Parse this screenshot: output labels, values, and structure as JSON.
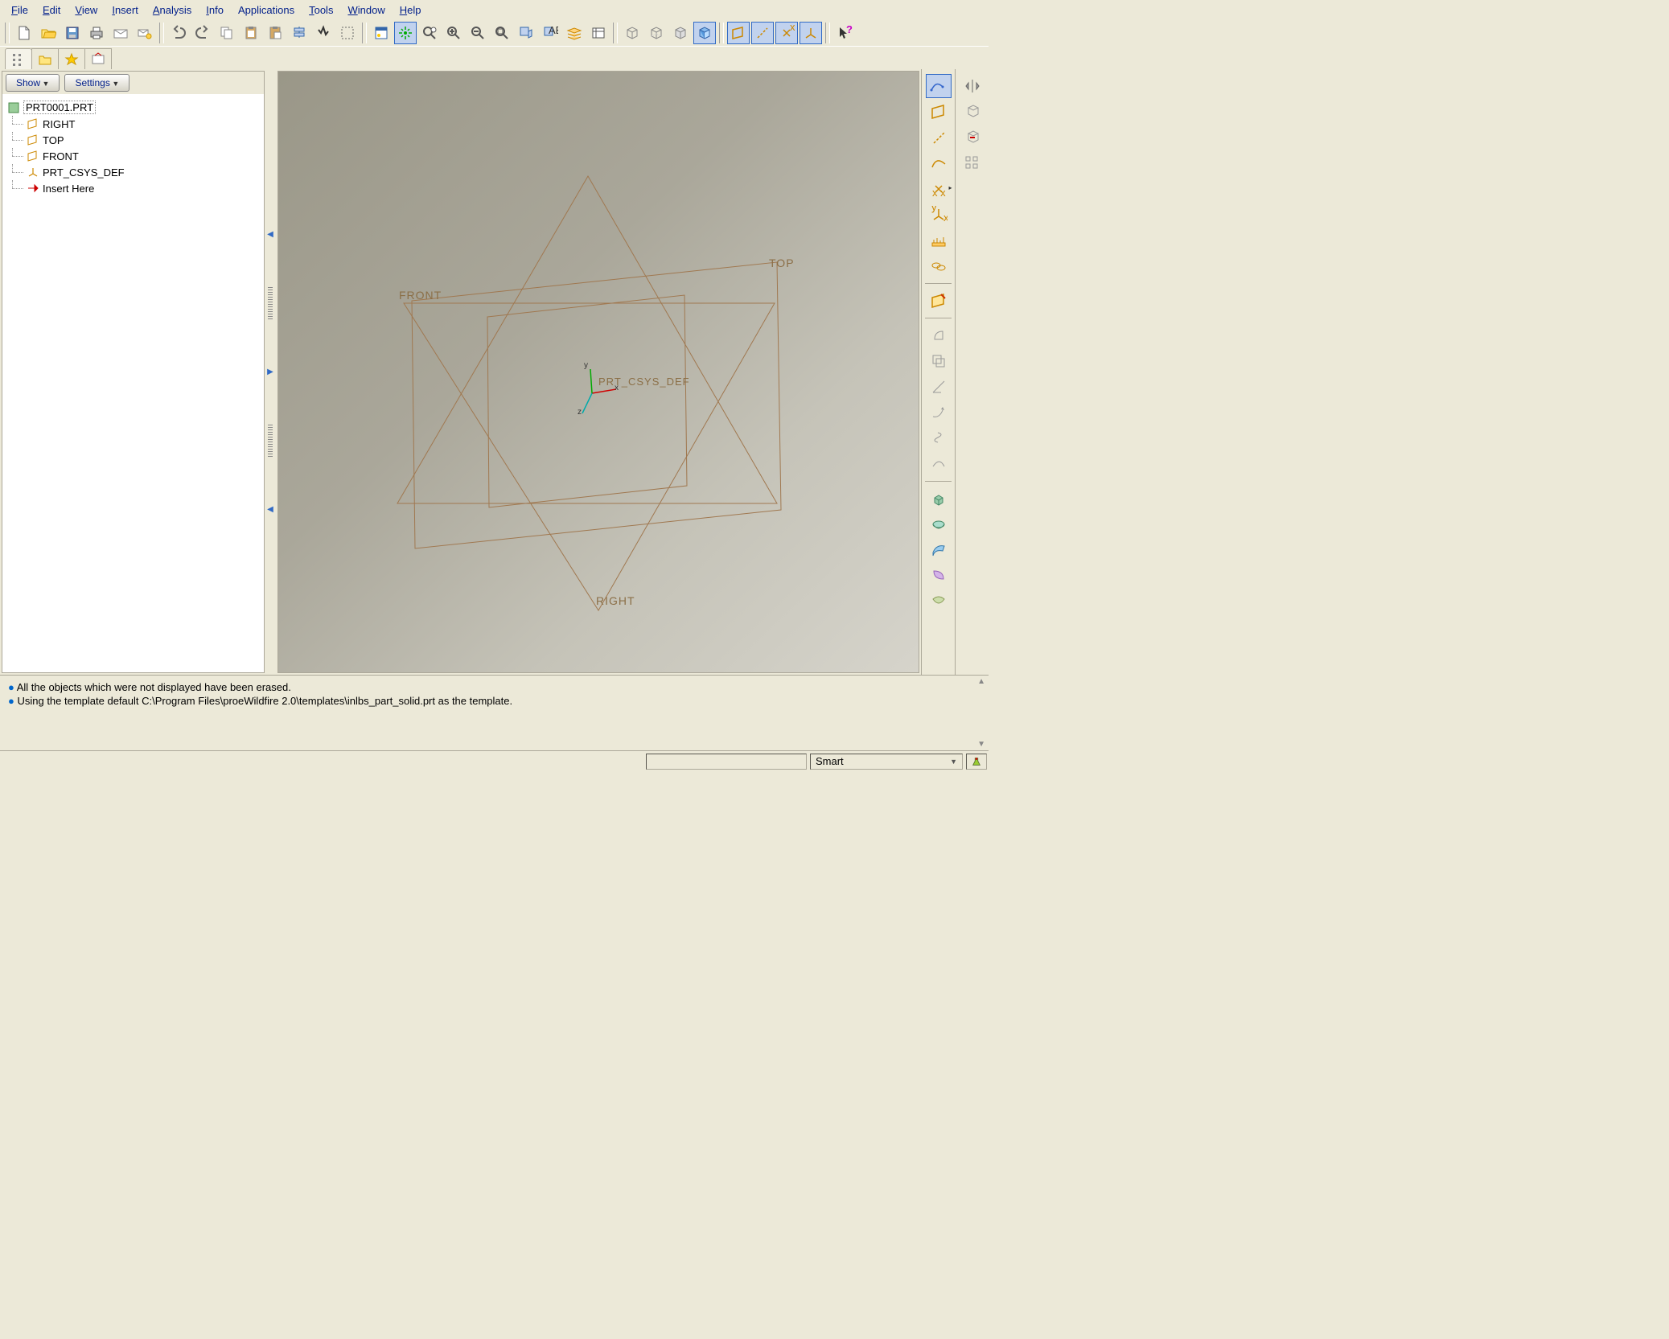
{
  "menu": [
    "File",
    "Edit",
    "View",
    "Insert",
    "Analysis",
    "Info",
    "Applications",
    "Tools",
    "Window",
    "Help"
  ],
  "menu_underline": [
    "F",
    "E",
    "V",
    "I",
    "A",
    "I",
    "",
    "T",
    "W",
    "H"
  ],
  "panel": {
    "show": "Show",
    "settings": "Settings"
  },
  "tree": {
    "root": "PRT0001.PRT",
    "items": [
      {
        "label": "RIGHT",
        "icon": "datum"
      },
      {
        "label": "TOP",
        "icon": "datum"
      },
      {
        "label": "FRONT",
        "icon": "datum"
      },
      {
        "label": "PRT_CSYS_DEF",
        "icon": "csys"
      },
      {
        "label": "Insert Here",
        "icon": "arrow"
      }
    ]
  },
  "viewport": {
    "labels": {
      "front": "FRONT",
      "top": "TOP",
      "right": "RIGHT",
      "csys": "PRT_CSYS_DEF",
      "x": "x",
      "y": "y",
      "z": "z"
    }
  },
  "messages": [
    "All the objects which were not displayed have been erased.",
    "Using the template default C:\\Program Files\\proeWildfire 2.0\\templates\\inlbs_part_solid.prt as the template."
  ],
  "status": {
    "filter": "Smart"
  }
}
